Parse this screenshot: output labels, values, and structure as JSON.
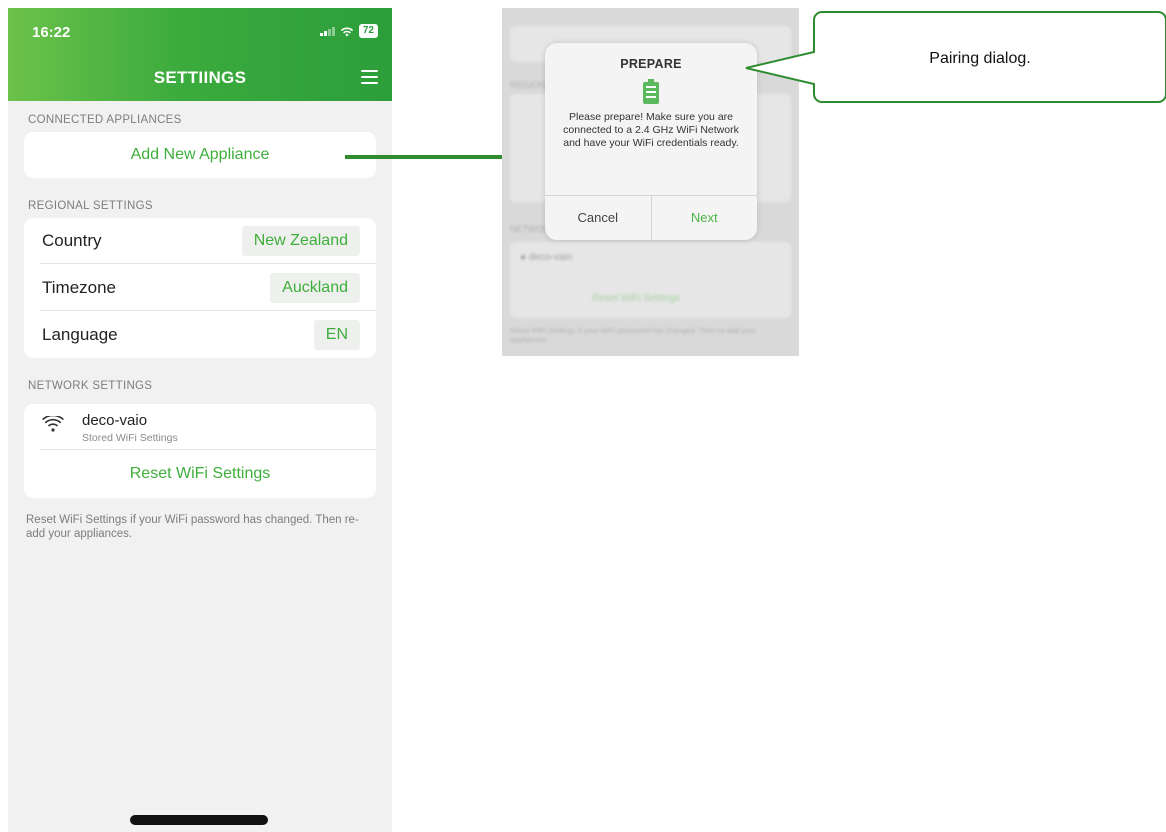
{
  "status": {
    "time": "16:22",
    "battery": "72"
  },
  "header": {
    "title": "SETTIINGS"
  },
  "connected": {
    "section_label": "CONNECTED APPLIANCES",
    "add_label": "Add New Appliance"
  },
  "regional": {
    "section_label": "REGIONAL SETTINGS",
    "rows": [
      {
        "label": "Country",
        "value": "New Zealand"
      },
      {
        "label": "Timezone",
        "value": "Auckland"
      },
      {
        "label": "Language",
        "value": "EN"
      }
    ]
  },
  "network": {
    "section_label": "NETWORK SETTINGS",
    "wifi_name": "deco-vaio",
    "wifi_sub": "Stored WiFi Settings",
    "reset_label": "Reset WiFi Settings",
    "help": "Reset WiFi Settings if your WiFi password has changed. Then re-add your appliances."
  },
  "dialog": {
    "title": "PREPARE",
    "message": "Please prepare! Make sure you are connected to a 2.4 GHz WiFi Network and have your WiFi credentials ready.",
    "cancel": "Cancel",
    "next": "Next"
  },
  "callout": {
    "text": "Pairing dialog."
  },
  "icons": {
    "menu": "hamburger-icon",
    "wifi": "wifi-icon",
    "prepare": "battery-list-icon",
    "arrow": "arrow-right"
  },
  "colors": {
    "accent": "#3fae3b",
    "header_green": "#2c9e3a",
    "callout_border": "#2e8b2e"
  }
}
